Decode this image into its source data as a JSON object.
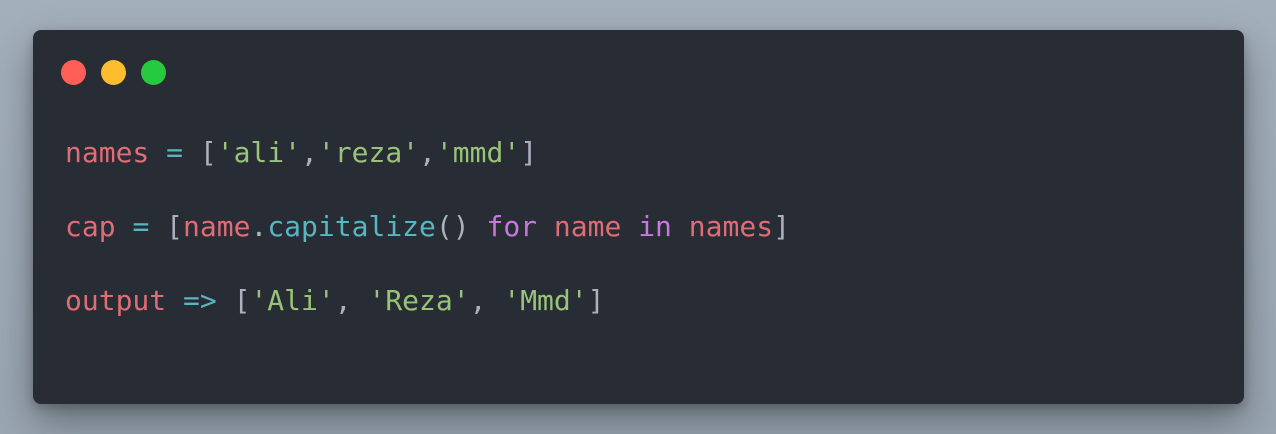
{
  "window": {
    "controls": [
      {
        "name": "close",
        "color": "#ff5f56"
      },
      {
        "name": "minimize",
        "color": "#ffbd2e"
      },
      {
        "name": "maximize",
        "color": "#27c93f"
      }
    ]
  },
  "code": {
    "lines": [
      [
        {
          "t": "names",
          "k": "var"
        },
        {
          "t": " ",
          "k": "punc"
        },
        {
          "t": "=",
          "k": "op"
        },
        {
          "t": " ",
          "k": "punc"
        },
        {
          "t": "[",
          "k": "punc"
        },
        {
          "t": "'ali'",
          "k": "str"
        },
        {
          "t": ",",
          "k": "punc"
        },
        {
          "t": "'reza'",
          "k": "str"
        },
        {
          "t": ",",
          "k": "punc"
        },
        {
          "t": "'mmd'",
          "k": "str"
        },
        {
          "t": "]",
          "k": "punc"
        }
      ],
      [],
      [
        {
          "t": "cap",
          "k": "var"
        },
        {
          "t": " ",
          "k": "punc"
        },
        {
          "t": "=",
          "k": "op"
        },
        {
          "t": " ",
          "k": "punc"
        },
        {
          "t": "[",
          "k": "punc"
        },
        {
          "t": "name",
          "k": "var"
        },
        {
          "t": ".",
          "k": "punc"
        },
        {
          "t": "capitalize",
          "k": "fn"
        },
        {
          "t": "()",
          "k": "punc"
        },
        {
          "t": " ",
          "k": "punc"
        },
        {
          "t": "for",
          "k": "kw"
        },
        {
          "t": " ",
          "k": "punc"
        },
        {
          "t": "name",
          "k": "var"
        },
        {
          "t": " ",
          "k": "punc"
        },
        {
          "t": "in",
          "k": "kw"
        },
        {
          "t": " ",
          "k": "punc"
        },
        {
          "t": "names",
          "k": "var"
        },
        {
          "t": "]",
          "k": "punc"
        }
      ],
      [],
      [
        {
          "t": "output",
          "k": "var"
        },
        {
          "t": " ",
          "k": "punc"
        },
        {
          "t": "=>",
          "k": "op"
        },
        {
          "t": " ",
          "k": "punc"
        },
        {
          "t": "[",
          "k": "punc"
        },
        {
          "t": "'Ali'",
          "k": "str"
        },
        {
          "t": ", ",
          "k": "punc"
        },
        {
          "t": "'Reza'",
          "k": "str"
        },
        {
          "t": ", ",
          "k": "punc"
        },
        {
          "t": "'Mmd'",
          "k": "str"
        },
        {
          "t": "]",
          "k": "punc"
        }
      ]
    ]
  }
}
